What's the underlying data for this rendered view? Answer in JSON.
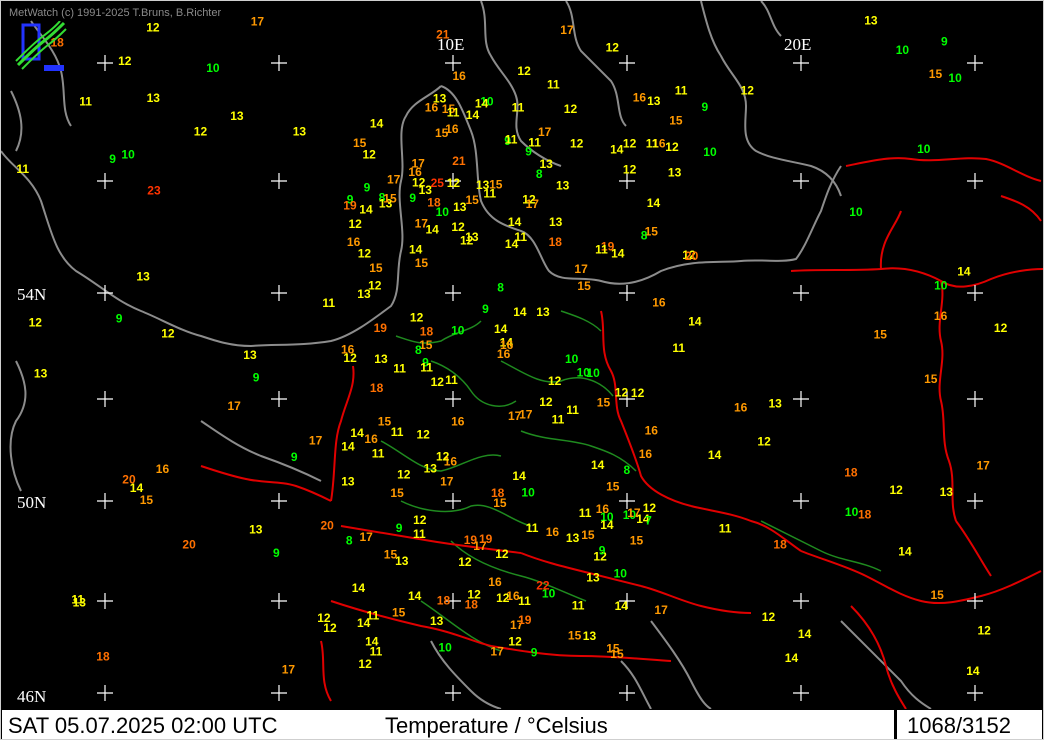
{
  "header": {
    "credit": "MetWatch  (c) 1991-2025 T.Bruns, B.Richter"
  },
  "footer": {
    "timestamp": "SAT 05.07.2025 02:00 UTC",
    "parameter": "Temperature / °Celsius",
    "counter": "1068/3152"
  },
  "grid_labels": [
    "10E",
    "20E",
    "54N",
    "50N",
    "46N"
  ],
  "colors": {
    "background": "#000000",
    "coastline": "#8c8c8c",
    "border": "#e00000",
    "terrain": "#1f8a1f",
    "temp_10_or_less": "#00ff00",
    "temp_11_14": "#ffff00",
    "temp_15_17": "#ff9900",
    "temp_18_21": "#ff7000",
    "temp_22_plus": "#ff3300"
  },
  "observations": [
    {
      "t": 15
    },
    {
      "t": 12
    },
    {
      "t": 14
    },
    {
      "t": 13
    },
    {
      "t": 14
    },
    {
      "t": 14
    },
    {
      "t": 12
    },
    {
      "t": 13
    },
    {
      "t": 12
    },
    {
      "t": 11
    },
    {
      "t": 12
    },
    {
      "t": 12
    },
    {
      "t": 14
    },
    {
      "t": 13
    },
    {
      "t": 14
    },
    {
      "t": 14
    },
    {
      "t": 13
    },
    {
      "t": 12
    },
    {
      "t": 12
    },
    {
      "t": 12
    },
    {
      "t": 13
    },
    {
      "t": 11
    },
    {
      "t": 12
    },
    {
      "t": 10
    },
    {
      "t": 15
    },
    {
      "t": 14
    },
    {
      "t": 15
    },
    {
      "t": 13
    },
    {
      "t": 12
    },
    {
      "t": 15
    },
    {
      "t": 14
    },
    {
      "t": 14
    },
    {
      "t": 15
    },
    {
      "t": 13
    },
    {
      "t": 12
    },
    {
      "t": 14
    },
    {
      "t": 12
    },
    {
      "t": 13
    },
    {
      "t": 11
    },
    {
      "t": 14
    },
    {
      "t": 13
    },
    {
      "t": 15
    },
    {
      "t": 14
    },
    {
      "t": 15
    },
    {
      "t": 14
    },
    {
      "t": 17
    },
    {
      "t": 15
    },
    {
      "t": 15
    },
    {
      "t": 15
    },
    {
      "t": 13
    },
    {
      "t": 12
    },
    {
      "t": 10
    },
    {
      "t": 11
    },
    {
      "t": 11
    },
    {
      "t": 11
    },
    {
      "t": 14
    },
    {
      "t": 15
    },
    {
      "t": 12
    },
    {
      "t": 10
    },
    {
      "t": 14
    },
    {
      "t": 16
    },
    {
      "t": 16
    },
    {
      "t": 15
    },
    {
      "t": 15
    },
    {
      "t": 15
    },
    {
      "t": 17
    },
    {
      "t": 13
    },
    {
      "t": 13
    },
    {
      "t": 14
    },
    {
      "t": 16
    },
    {
      "t": 16
    },
    {
      "t": 13
    },
    {
      "t": 12
    },
    {
      "t": 15
    },
    {
      "t": 17
    },
    {
      "t": 17
    },
    {
      "t": 16
    },
    {
      "t": 15
    },
    {
      "t": 16
    },
    {
      "t": 15
    },
    {
      "t": 18
    },
    {
      "t": 17
    },
    {
      "t": 16
    },
    {
      "t": 16
    },
    {
      "t": 16
    },
    {
      "t": 17
    },
    {
      "t": 17
    },
    {
      "t": 19
    },
    {
      "t": 16
    },
    {
      "t": 12
    },
    {
      "t": 13
    },
    {
      "t": 16
    },
    {
      "t": 11
    },
    {
      "t": 10
    },
    {
      "t": 9
    },
    {
      "t": 16
    },
    {
      "t": 16
    },
    {
      "t": 17
    },
    {
      "t": 17
    },
    {
      "t": 18
    },
    {
      "t": 18
    },
    {
      "t": 19
    },
    {
      "t": 20
    },
    {
      "t": 19
    },
    {
      "t": 18
    },
    {
      "t": 17
    },
    {
      "t": 15
    },
    {
      "t": 14
    },
    {
      "t": 12
    },
    {
      "t": 9
    },
    {
      "t": 12
    },
    {
      "t": 9
    },
    {
      "t": 10
    },
    {
      "t": 8
    },
    {
      "t": 11
    },
    {
      "t": 13
    },
    {
      "t": 12
    },
    {
      "t": 13
    },
    {
      "t": 12
    },
    {
      "t": 15
    },
    {
      "t": 11
    },
    {
      "t": 10
    },
    {
      "t": 10
    },
    {
      "t": 12
    },
    {
      "t": 9
    },
    {
      "t": 13
    },
    {
      "t": 8
    },
    {
      "t": 9
    },
    {
      "t": 9
    },
    {
      "t": 10
    },
    {
      "t": 8
    },
    {
      "t": 11
    },
    {
      "t": 11
    },
    {
      "t": 12
    },
    {
      "t": 11
    },
    {
      "t": 12
    },
    {
      "t": 14
    },
    {
      "t": 11
    },
    {
      "t": 17
    },
    {
      "t": 9
    },
    {
      "t": 9
    },
    {
      "t": 13
    },
    {
      "t": 14
    },
    {
      "t": 15
    },
    {
      "t": 13
    },
    {
      "t": 11
    },
    {
      "t": 10
    },
    {
      "t": 8
    },
    {
      "t": 9
    },
    {
      "t": 11
    },
    {
      "t": 12
    },
    {
      "t": 16
    },
    {
      "t": 15
    },
    {
      "t": 16
    },
    {
      "t": 17
    },
    {
      "t": 18
    },
    {
      "t": 16
    },
    {
      "t": 17
    },
    {
      "t": 16
    },
    {
      "t": 14
    },
    {
      "t": 12
    },
    {
      "t": 11
    },
    {
      "t": 9
    },
    {
      "t": 12
    },
    {
      "t": 10
    },
    {
      "t": 11
    },
    {
      "t": 10
    },
    {
      "t": 11
    },
    {
      "t": 12
    },
    {
      "t": 9
    },
    {
      "t": 8
    },
    {
      "t": 7
    },
    {
      "t": 12
    },
    {
      "t": 10
    },
    {
      "t": 9
    },
    {
      "t": 12
    },
    {
      "t": 14
    },
    {
      "t": 15
    },
    {
      "t": 17
    },
    {
      "t": 14
    },
    {
      "t": 13
    },
    {
      "t": 14
    },
    {
      "t": 13
    },
    {
      "t": 12
    },
    {
      "t": 11
    },
    {
      "t": 12
    },
    {
      "t": 11
    },
    {
      "t": 10
    },
    {
      "t": 8
    },
    {
      "t": 10
    },
    {
      "t": 12
    },
    {
      "t": 15
    },
    {
      "t": 17
    },
    {
      "t": 18
    },
    {
      "t": 16
    },
    {
      "t": 15
    },
    {
      "t": 13
    },
    {
      "t": 14
    },
    {
      "t": 13
    },
    {
      "t": 12
    },
    {
      "t": 11
    },
    {
      "t": 11
    },
    {
      "t": 12
    },
    {
      "t": 12
    },
    {
      "t": 10
    },
    {
      "t": 11
    },
    {
      "t": 9
    },
    {
      "t": 10
    },
    {
      "t": 8
    },
    {
      "t": 9
    },
    {
      "t": 10
    },
    {
      "t": 9
    },
    {
      "t": 11
    },
    {
      "t": 13
    },
    {
      "t": 12
    },
    {
      "t": 14
    },
    {
      "t": 12
    },
    {
      "t": 11
    },
    {
      "t": 12
    },
    {
      "t": 10
    },
    {
      "t": 9
    },
    {
      "t": 12
    },
    {
      "t": 14
    },
    {
      "t": 14
    },
    {
      "t": 12
    },
    {
      "t": 13
    },
    {
      "t": 12
    },
    {
      "t": 11
    },
    {
      "t": 10
    },
    {
      "t": 12
    },
    {
      "t": 11
    },
    {
      "t": 13
    },
    {
      "t": 15
    },
    {
      "t": 14
    },
    {
      "t": 12
    },
    {
      "t": 13
    },
    {
      "t": 12
    },
    {
      "t": 9
    },
    {
      "t": 14
    },
    {
      "t": 13
    },
    {
      "t": 12
    },
    {
      "t": 13
    },
    {
      "t": 11
    },
    {
      "t": 12
    },
    {
      "t": 10
    },
    {
      "t": 15
    },
    {
      "t": 14
    },
    {
      "t": 17
    },
    {
      "t": 13
    },
    {
      "t": 14
    },
    {
      "t": 18
    },
    {
      "t": 15
    },
    {
      "t": 16
    },
    {
      "t": 15
    },
    {
      "t": 16
    },
    {
      "t": 16
    },
    {
      "t": 17
    },
    {
      "t": 17
    },
    {
      "t": 17
    },
    {
      "t": 19
    },
    {
      "t": 18
    },
    {
      "t": 20
    },
    {
      "t": 22
    },
    {
      "t": 21
    },
    {
      "t": 20
    },
    {
      "t": 23
    },
    {
      "t": 25
    },
    {
      "t": 19
    },
    {
      "t": 18
    },
    {
      "t": 18
    },
    {
      "t": 17
    },
    {
      "t": 12
    },
    {
      "t": 11
    },
    {
      "t": 14
    },
    {
      "t": 13
    },
    {
      "t": 14
    },
    {
      "t": 12
    },
    {
      "t": 10
    },
    {
      "t": 11
    },
    {
      "t": 13
    },
    {
      "t": 12
    },
    {
      "t": 16
    },
    {
      "t": 18
    },
    {
      "t": 17
    },
    {
      "t": 15
    },
    {
      "t": 16
    },
    {
      "t": 18
    },
    {
      "t": 20
    },
    {
      "t": 21
    },
    {
      "t": 19
    }
  ]
}
